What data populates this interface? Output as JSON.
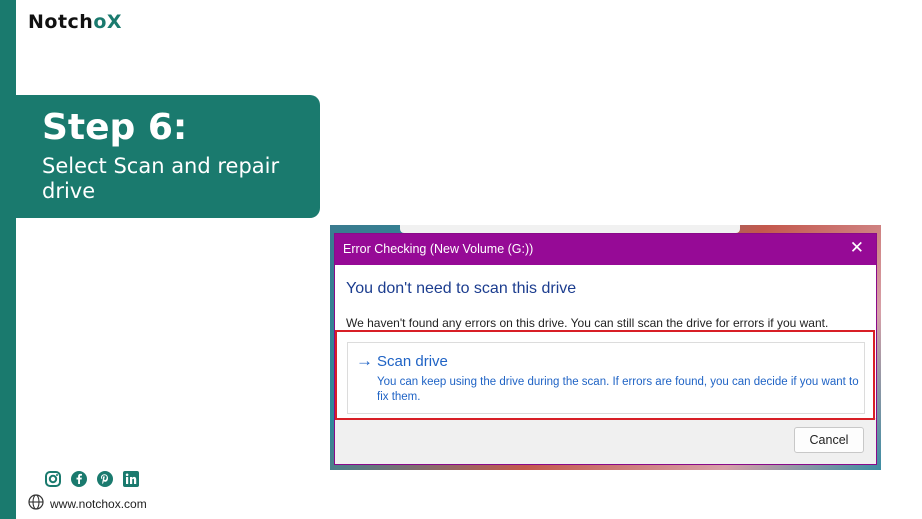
{
  "brand": {
    "logo_prefix": "Notch",
    "logo_o": "o",
    "logo_x": "X",
    "accent": "#1a7a6e"
  },
  "step": {
    "title": "Step 6:",
    "subtitle": "Select Scan and repair drive"
  },
  "dialog": {
    "title": "Error Checking (New Volume (G:))",
    "close_glyph": "✕",
    "heading": "You don't need to scan this drive",
    "message": "We haven't found any errors on this drive. You can still scan the drive for errors if you want.",
    "option": {
      "arrow": "→",
      "title": "Scan drive",
      "description": "You can keep using the drive during the scan. If errors are found, you can decide if you want to fix them."
    },
    "cancel_label": "Cancel",
    "titlebar_color": "#960a96",
    "link_color": "#1f63c5",
    "highlight_color": "#d81f26"
  },
  "footer": {
    "icons": [
      "instagram-icon",
      "facebook-icon",
      "pinterest-icon",
      "linkedin-icon"
    ],
    "website": "www.notchox.com"
  }
}
